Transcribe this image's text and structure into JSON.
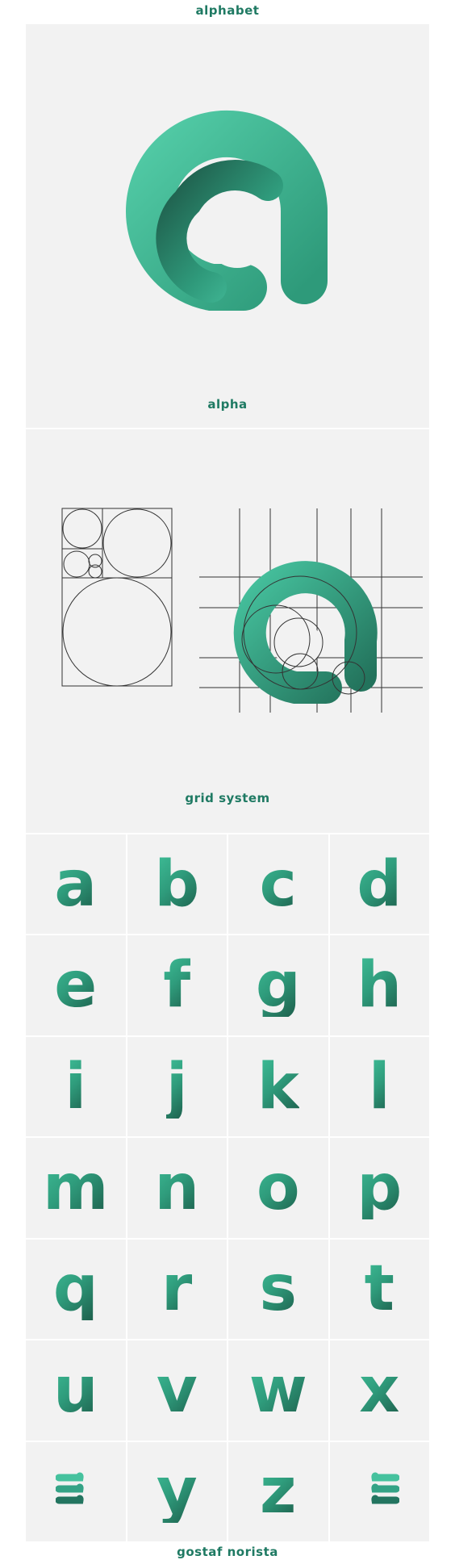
{
  "header": {
    "title": "alphabet"
  },
  "hero": {
    "label": "alpha"
  },
  "grid_section": {
    "label": "grid system"
  },
  "letters": [
    "a",
    "b",
    "c",
    "d",
    "e",
    "f",
    "g",
    "h",
    "i",
    "j",
    "k",
    "l",
    "m",
    "n",
    "o",
    "p",
    "q",
    "r",
    "s",
    "t",
    "u",
    "v",
    "w",
    "x",
    "",
    "y",
    "z",
    ""
  ],
  "footer": {
    "credit": "gostaf norista"
  },
  "colors": {
    "accent": "#44c19d",
    "accent_dark": "#1c5a48",
    "text": "#1f7a63",
    "panel_bg": "#f2f2f2"
  }
}
